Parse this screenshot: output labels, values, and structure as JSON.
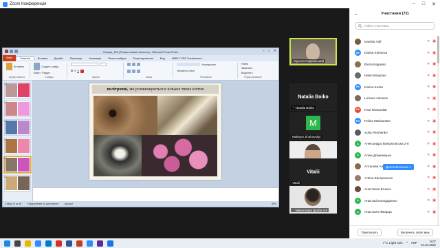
{
  "zoom": {
    "title": "Zoom Конференція"
  },
  "ppt": {
    "window_title": "Лекция_№3 (Режим совместимости) - Microsoft PowerPoint",
    "tabs": [
      "Файл",
      "Главная",
      "Вставка",
      "Дизайн",
      "Переходы",
      "Анимация",
      "Показ слайдов",
      "Рецензирование",
      "Вид",
      "ABBYY PDF Transformer+"
    ],
    "ribbon_groups": [
      "Буфер обмена",
      "Слайды",
      "Шрифт",
      "Абзац",
      "Рисование",
      "Редактирование"
    ],
    "ribbon_labels": {
      "paste": "Вставить",
      "create_slide": "Создать слайд",
      "layout": "Макет",
      "reset": "Восстановить",
      "section": "Раздел",
      "find": "Найти",
      "replace": "Заменить",
      "select": "Выделить",
      "arrange": "Упорядочить",
      "express": "Экспресс-стили"
    },
    "slide_title_bold": "політропні,",
    "slide_title_rest": "які розмножуються в кількох типах клітин",
    "status": {
      "slide": "Слайд 19 из 45",
      "theme": "\"Оформление по умолчанию\"",
      "lang": "русский",
      "zoom": "58%"
    }
  },
  "video_tiles": [
    {
      "name": "Мукола Радковський",
      "type": "video",
      "muted": false
    },
    {
      "name": "Natalia Boiko",
      "big_name": "Natalia Boiko",
      "type": "name",
      "muted": true
    },
    {
      "name": "Maksym Zhukovskyi",
      "type": "avatar",
      "letter": "M",
      "muted": true
    },
    {
      "name": "Владимир Мельник",
      "type": "photo",
      "muted": true
    },
    {
      "name": "Vitalii",
      "big_name": "Vitalii",
      "type": "name",
      "muted": false
    },
    {
      "name": "Мирослава Дзяба 2-8",
      "type": "photo",
      "muted": true
    }
  ],
  "panel": {
    "title": "Участники (72)",
    "search_placeholder": "Найти участника",
    "more_button": "Дополнительно >",
    "invite": "Пригласить",
    "unmute_me": "Включить свой звук",
    "participants": [
      {
        "name": "Daniela Volf",
        "initials": "",
        "color": "#7a5c3a"
      },
      {
        "name": "Dasha Kolosova",
        "initials": "DK",
        "color": "#2d8cff"
      },
      {
        "name": "Elena Naganko",
        "initials": "",
        "color": "#8c6d4c"
      },
      {
        "name": "Helen Bergman",
        "initials": "",
        "color": "#6a6a6a"
      },
      {
        "name": "Karina Kuzko",
        "initials": "KK",
        "color": "#2d8cff"
      },
      {
        "name": "Luciano Honeine",
        "initials": "",
        "color": "#7a6a5a"
      },
      {
        "name": "Paul Sharandak",
        "initials": "PS",
        "color": "#e04a3a"
      },
      {
        "name": "Polina Markaustan",
        "initials": "PM",
        "color": "#2d8cff"
      },
      {
        "name": "Sofia Pershenko",
        "initials": "",
        "color": "#5a5a5a"
      },
      {
        "name": "Александра Войцеховська 2-8",
        "initials": "A",
        "color": "#2db84c"
      },
      {
        "name": "Аліна Доманицька",
        "initials": "A",
        "color": "#2db84c"
      },
      {
        "name": "Алтунова Анаст...",
        "initials": "",
        "color": "#8a6a4a"
      },
      {
        "name": "Алёна Евстратенко",
        "initials": "",
        "color": "#9a7a6a"
      },
      {
        "name": "Анастасия Бланко",
        "initials": "",
        "color": "#6a4a3a"
      },
      {
        "name": "Анастасія Бондаренко",
        "initials": "A",
        "color": "#2db84c"
      },
      {
        "name": "Анастасія Лімарца",
        "initials": "A",
        "color": "#2db84c"
      }
    ]
  },
  "taskbar": {
    "weather": "7°C Light rain",
    "lang": "УКР",
    "time": "9:07",
    "date": "01.04.2022",
    "icon_colors": [
      "#1e88e5",
      "#444",
      "#f0b400",
      "#2d8cff",
      "#0078d4",
      "#d93025",
      "#2b579a",
      "#c43e1c",
      "#2d8cff",
      "#5c2d91",
      "#1a73e8"
    ]
  }
}
